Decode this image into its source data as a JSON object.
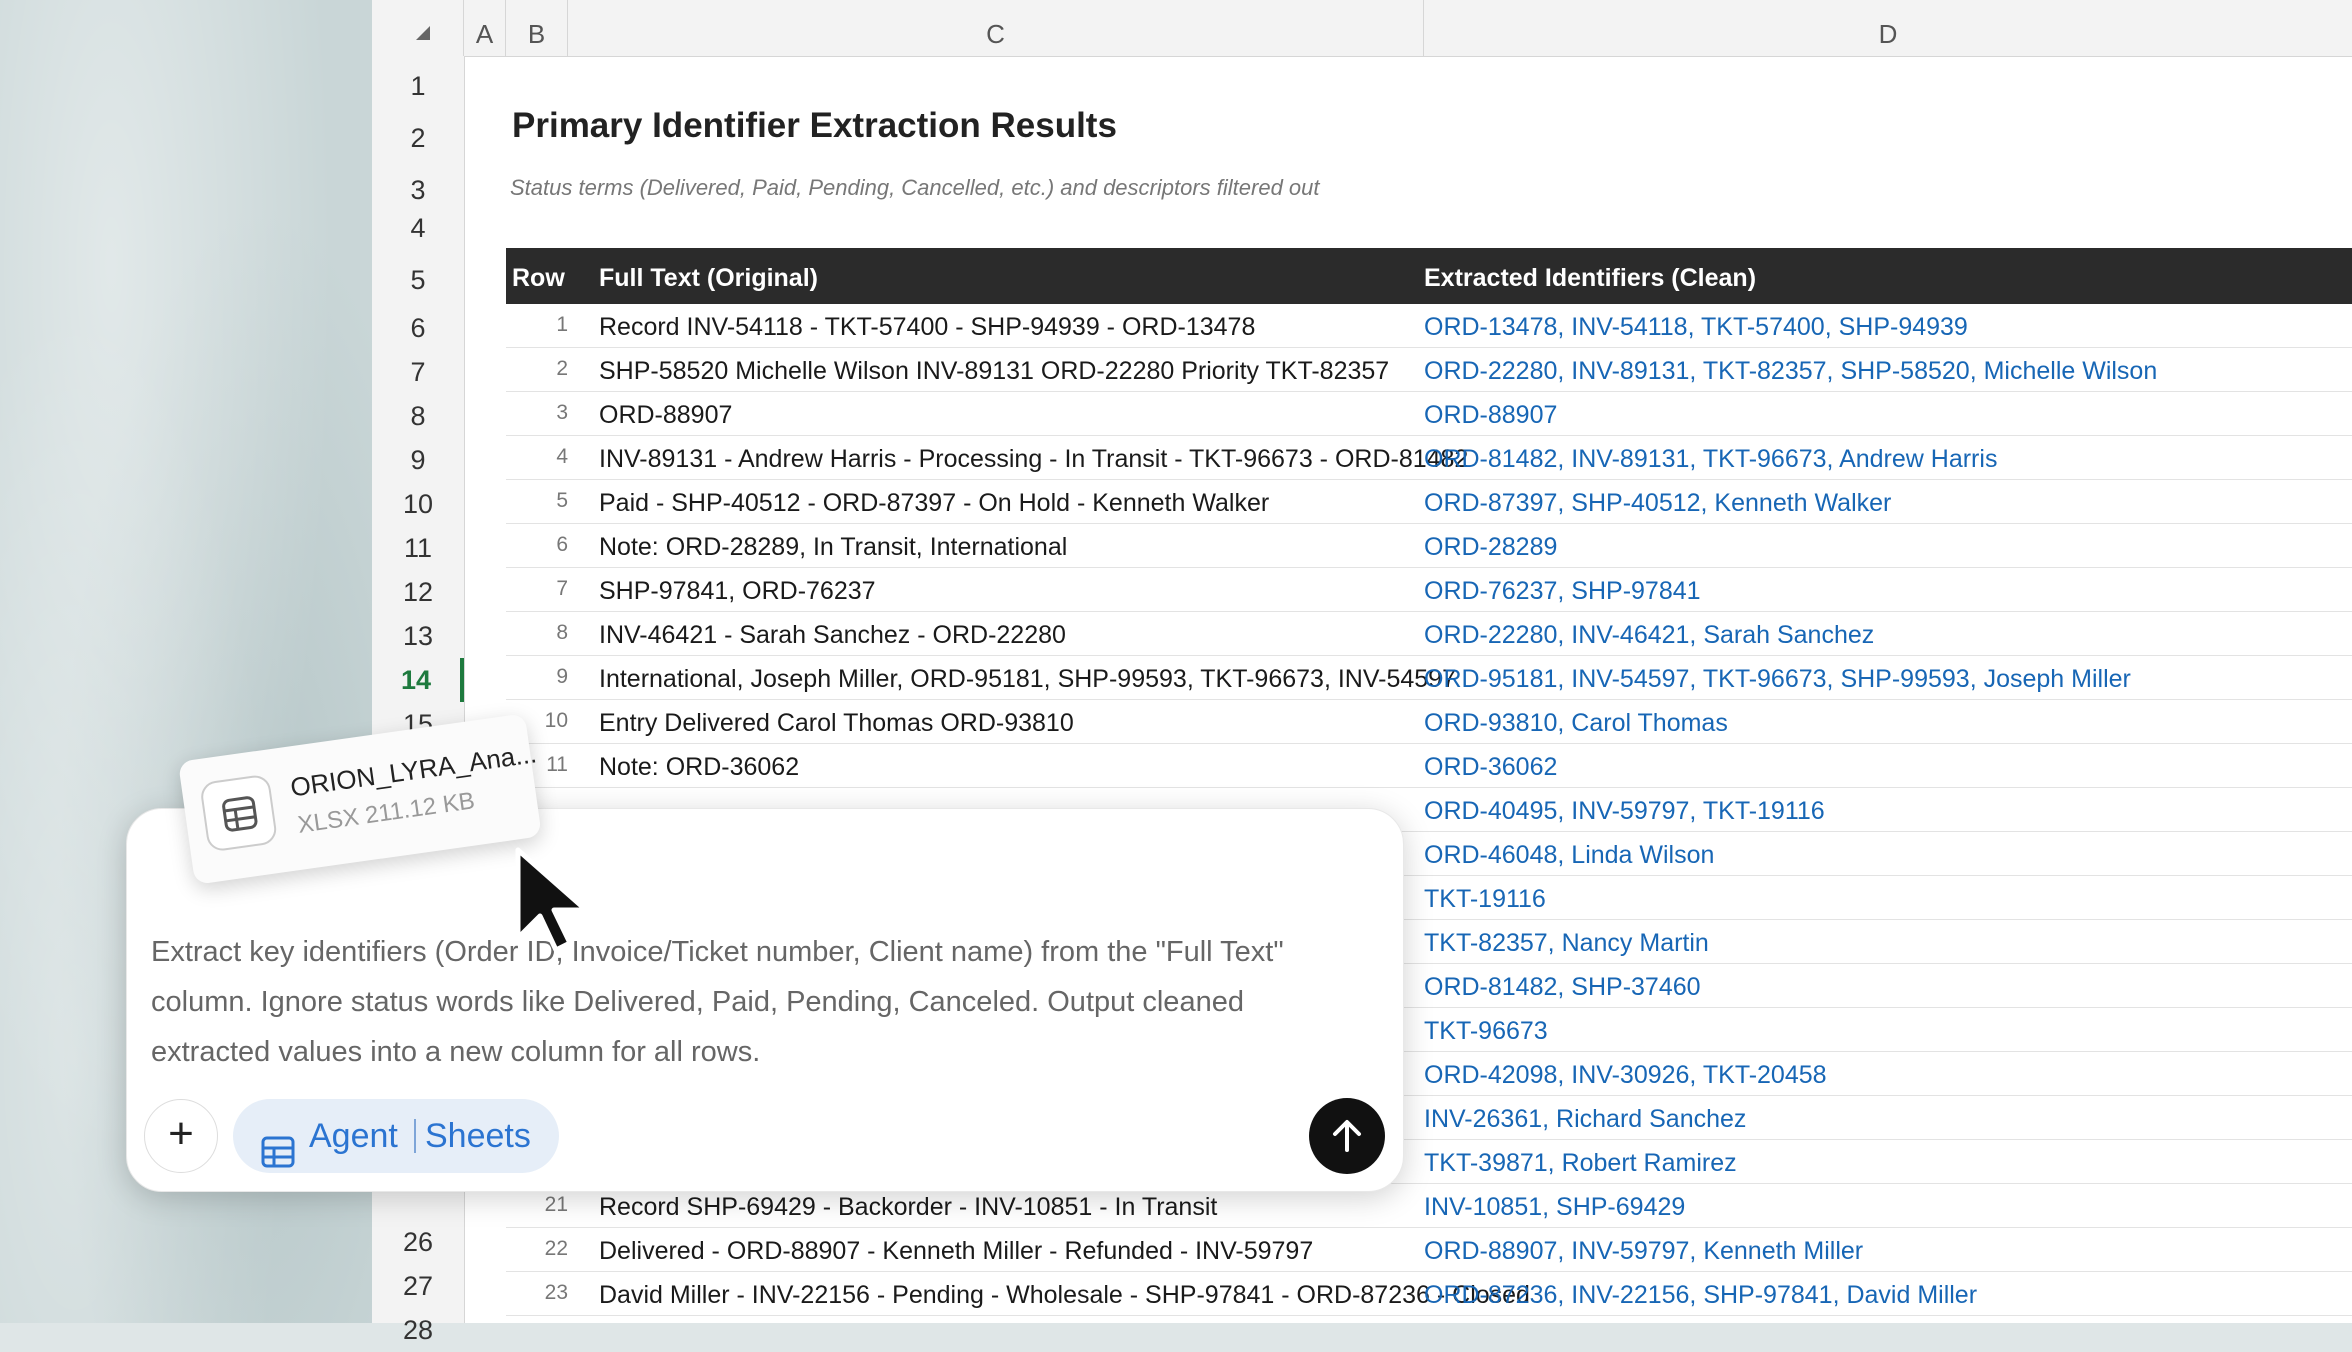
{
  "sheet": {
    "columns": [
      "A",
      "B",
      "C",
      "D"
    ],
    "row_numbers": [
      "1",
      "2",
      "3",
      "4",
      "5",
      "6",
      "7",
      "8",
      "9",
      "10",
      "11",
      "12",
      "13",
      "14",
      "15",
      "26",
      "27",
      "28"
    ],
    "active_row": "14",
    "title": "Primary Identifier Extraction Results",
    "subtitle": "Status terms (Delivered, Paid, Pending, Cancelled, etc.) and descriptors filtered out",
    "headers": {
      "row": "Row",
      "full_text": "Full Text (Original)",
      "extracted": "Extracted Identifiers (Clean)"
    },
    "rows": [
      {
        "num": "1",
        "full": "Record INV-54118 - TKT-57400 - SHP-94939 - ORD-13478",
        "ext": "ORD-13478, INV-54118, TKT-57400, SHP-94939"
      },
      {
        "num": "2",
        "full": "SHP-58520 Michelle Wilson INV-89131 ORD-22280 Priority TKT-82357",
        "ext": "ORD-22280, INV-89131, TKT-82357, SHP-58520, Michelle Wilson"
      },
      {
        "num": "3",
        "full": "ORD-88907",
        "ext": "ORD-88907"
      },
      {
        "num": "4",
        "full": "INV-89131 - Andrew Harris - Processing - In Transit - TKT-96673 - ORD-81482",
        "ext": "ORD-81482, INV-89131, TKT-96673, Andrew Harris"
      },
      {
        "num": "5",
        "full": "Paid - SHP-40512 - ORD-87397 - On Hold - Kenneth Walker",
        "ext": "ORD-87397, SHP-40512, Kenneth Walker"
      },
      {
        "num": "6",
        "full": "Note: ORD-28289, In Transit, International",
        "ext": "ORD-28289"
      },
      {
        "num": "7",
        "full": "SHP-97841, ORD-76237",
        "ext": "ORD-76237, SHP-97841"
      },
      {
        "num": "8",
        "full": "INV-46421 - Sarah Sanchez - ORD-22280",
        "ext": "ORD-22280, INV-46421, Sarah Sanchez"
      },
      {
        "num": "9",
        "full": "International, Joseph Miller, ORD-95181, SHP-99593, TKT-96673, INV-54597",
        "ext": "ORD-95181, INV-54597, TKT-96673, SHP-99593, Joseph Miller"
      },
      {
        "num": "10",
        "full": "Entry Delivered Carol Thomas ORD-93810",
        "ext": "ORD-93810, Carol Thomas"
      },
      {
        "num": "11",
        "full": "Note: ORD-36062",
        "ext": "ORD-36062"
      },
      {
        "num": "",
        "full": "",
        "ext": "ORD-40495, INV-59797, TKT-19116"
      },
      {
        "num": "",
        "full": "",
        "ext": "ORD-46048, Linda Wilson"
      },
      {
        "num": "",
        "full": "",
        "ext": "TKT-19116"
      },
      {
        "num": "",
        "full": "",
        "ext": "TKT-82357, Nancy Martin"
      },
      {
        "num": "",
        "full": "",
        "ext": "ORD-81482, SHP-37460"
      },
      {
        "num": "",
        "full": "",
        "ext": "TKT-96673"
      },
      {
        "num": "",
        "full": "",
        "ext": "ORD-42098, INV-30926, TKT-20458"
      },
      {
        "num": "",
        "full": "",
        "ext": "INV-26361, Richard Sanchez"
      },
      {
        "num": "",
        "full": "",
        "ext": "TKT-39871, Robert Ramirez"
      },
      {
        "num": "21",
        "full": "Record SHP-69429 - Backorder - INV-10851 - In Transit",
        "ext": "INV-10851, SHP-69429"
      },
      {
        "num": "22",
        "full": "Delivered - ORD-88907 - Kenneth Miller - Refunded - INV-59797",
        "ext": "ORD-88907, INV-59797, Kenneth Miller"
      },
      {
        "num": "23",
        "full": "David Miller - INV-22156 - Pending - Wholesale - SHP-97841 - ORD-87236 - Closed",
        "ext": "ORD-87236, INV-22156, SHP-97841, David Miller"
      }
    ]
  },
  "attachment": {
    "name": "ORION_LYRA_Ana...",
    "meta": "XLSX 211.12 KB",
    "icon": "spreadsheet-icon"
  },
  "chat": {
    "prompt": "Extract key identifiers (Order ID, Invoice/Ticket number, Client name) from the \"Full Text\" column. Ignore status words like Delivered, Paid, Pending, Canceled. Output cleaned extracted values into a new column for all rows.",
    "plus_label": "+",
    "agent_label": "Agent",
    "sheets_label": "Sheets",
    "accent": "#2b74d1"
  }
}
